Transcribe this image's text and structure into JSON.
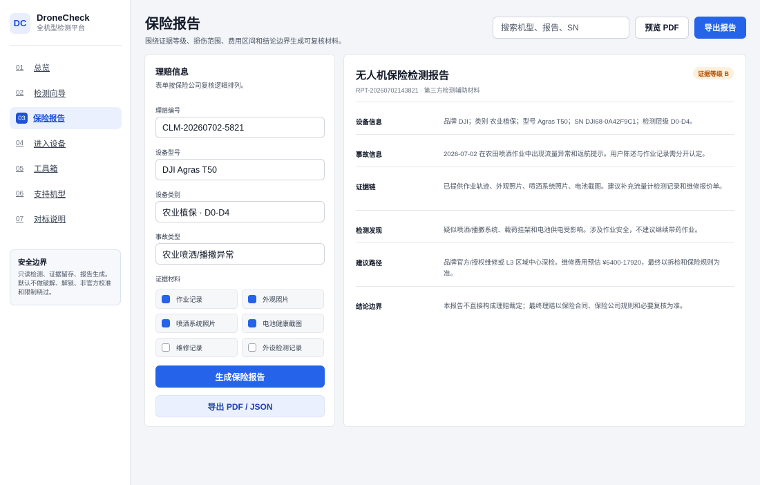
{
  "brand": {
    "logo": "DC",
    "name": "DroneCheck",
    "subtitle": "全机型检测平台"
  },
  "nav": [
    {
      "num": "01",
      "label": "总览"
    },
    {
      "num": "02",
      "label": "检测向导"
    },
    {
      "num": "03",
      "label": "保险报告",
      "active": true
    },
    {
      "num": "04",
      "label": "进入设备"
    },
    {
      "num": "05",
      "label": "工具箱"
    },
    {
      "num": "06",
      "label": "支持机型"
    },
    {
      "num": "07",
      "label": "对标说明"
    }
  ],
  "safety": {
    "title": "安全边界",
    "text": "只读检测、证据留存、报告生成。默认不做破解、解锁、非官方校准和限制绕过。"
  },
  "header": {
    "title": "保险报告",
    "subtitle": "围绕证据等级、损伤范围、费用区间和结论边界生成可复核材料。",
    "search_placeholder": "搜索机型、报告、SN",
    "preview_label": "预览 PDF",
    "export_label": "导出报告"
  },
  "claim": {
    "title": "理赔信息",
    "desc": "表单按保险公司复核逻辑排列。",
    "fields": [
      {
        "label": "理赔编号",
        "value": "CLM-20260702-5821"
      },
      {
        "label": "设备型号",
        "value": "DJI Agras T50"
      },
      {
        "label": "设备类别",
        "value": "农业植保 · D0-D4"
      },
      {
        "label": "事故类型",
        "value": "农业喷洒/播撒异常"
      }
    ],
    "evidence_label": "证据材料",
    "evidence": [
      {
        "label": "作业记录",
        "checked": true
      },
      {
        "label": "外观照片",
        "checked": true
      },
      {
        "label": "喷洒系统照片",
        "checked": true
      },
      {
        "label": "电池健康截图",
        "checked": true
      },
      {
        "label": "维修记录",
        "checked": false
      },
      {
        "label": "外设检测记录",
        "checked": false
      }
    ],
    "generate_label": "生成保险报告",
    "export_label": "导出 PDF / JSON"
  },
  "report": {
    "title": "无人机保险检测报告",
    "meta": "RPT-20260702143821 · 第三方检测辅助材料",
    "grade": "证据等级 B",
    "rows": [
      {
        "key": "设备信息",
        "value": "品牌 DJI；类别 农业植保；型号 Agras T50；SN DJI68-0A42F9C1；检测层级 D0-D4。"
      },
      {
        "key": "事故信息",
        "value": "2026-07-02 在农田喷洒作业中出现流量异常和返航提示。用户陈述与作业记录需分开认定。"
      },
      {
        "key": "证据链",
        "value": "已提供作业轨迹、外观照片、喷洒系统照片、电池截图。建议补充流量计检测记录和维修报价单。"
      },
      {
        "key": "检测发现",
        "value": "疑似喷洒/播撒系统、载荷挂架和电池供电受影响。涉及作业安全，不建议继续带药作业。"
      },
      {
        "key": "建议路径",
        "value": "品牌官方/授权维修或 L3 区域中心深检。维修费用预估 ¥6400-17920，最终以拆检和保险规则为准。"
      },
      {
        "key": "结论边界",
        "value": "本报告不直接构成理赔裁定；最终理赔以保险合同、保险公司规则和必要复核为准。"
      }
    ]
  }
}
